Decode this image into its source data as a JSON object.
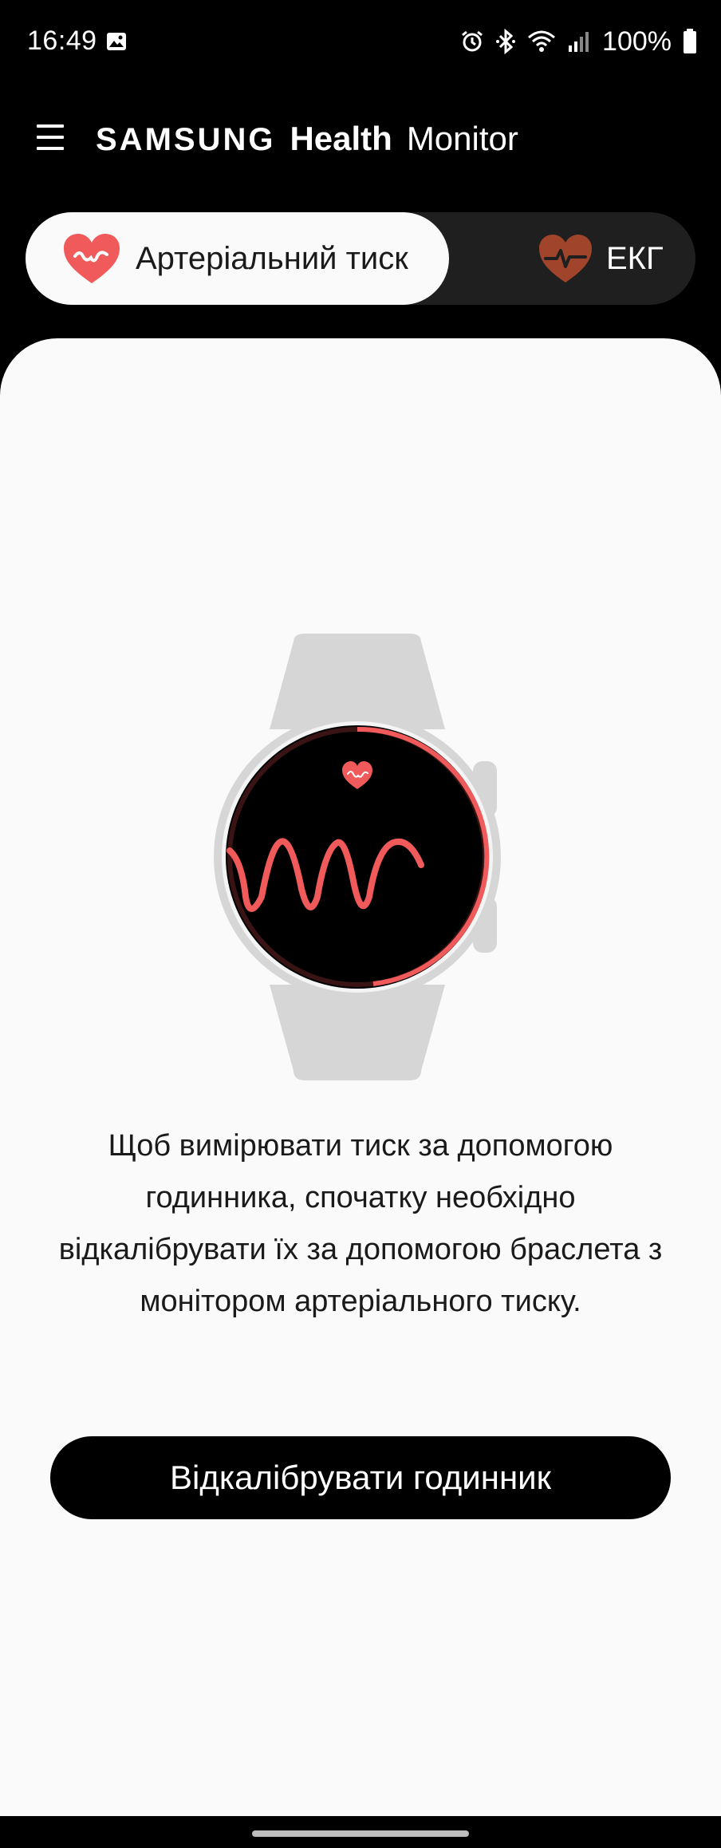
{
  "status_bar": {
    "time": "16:49",
    "battery": "100%",
    "icons": [
      "gallery-icon",
      "alarm-icon",
      "bluetooth-icon",
      "wifi-icon",
      "signal-icon",
      "battery-icon"
    ]
  },
  "header": {
    "brand_samsung": "SAMSUNG",
    "brand_health": "Health",
    "brand_monitor": "Monitor"
  },
  "tabs": [
    {
      "label": "Артеріальний тиск",
      "selected": true,
      "icon": "heart-pulse-icon"
    },
    {
      "label": "ЕКГ",
      "selected": false,
      "icon": "heart-ecg-icon"
    }
  ],
  "main": {
    "description": "Щоб вимірювати тиск за допомогою годинника, спочатку необхідно відкалібрувати їх за допомогою браслета з монітором артеріального тиску.",
    "calibrate_button": "Відкалібрувати годинник"
  },
  "colors": {
    "accent_red": "#f05a5a",
    "ecg_brown": "#a0452b",
    "card_bg": "#fafafa",
    "watch_body": "#d6d6d6"
  }
}
